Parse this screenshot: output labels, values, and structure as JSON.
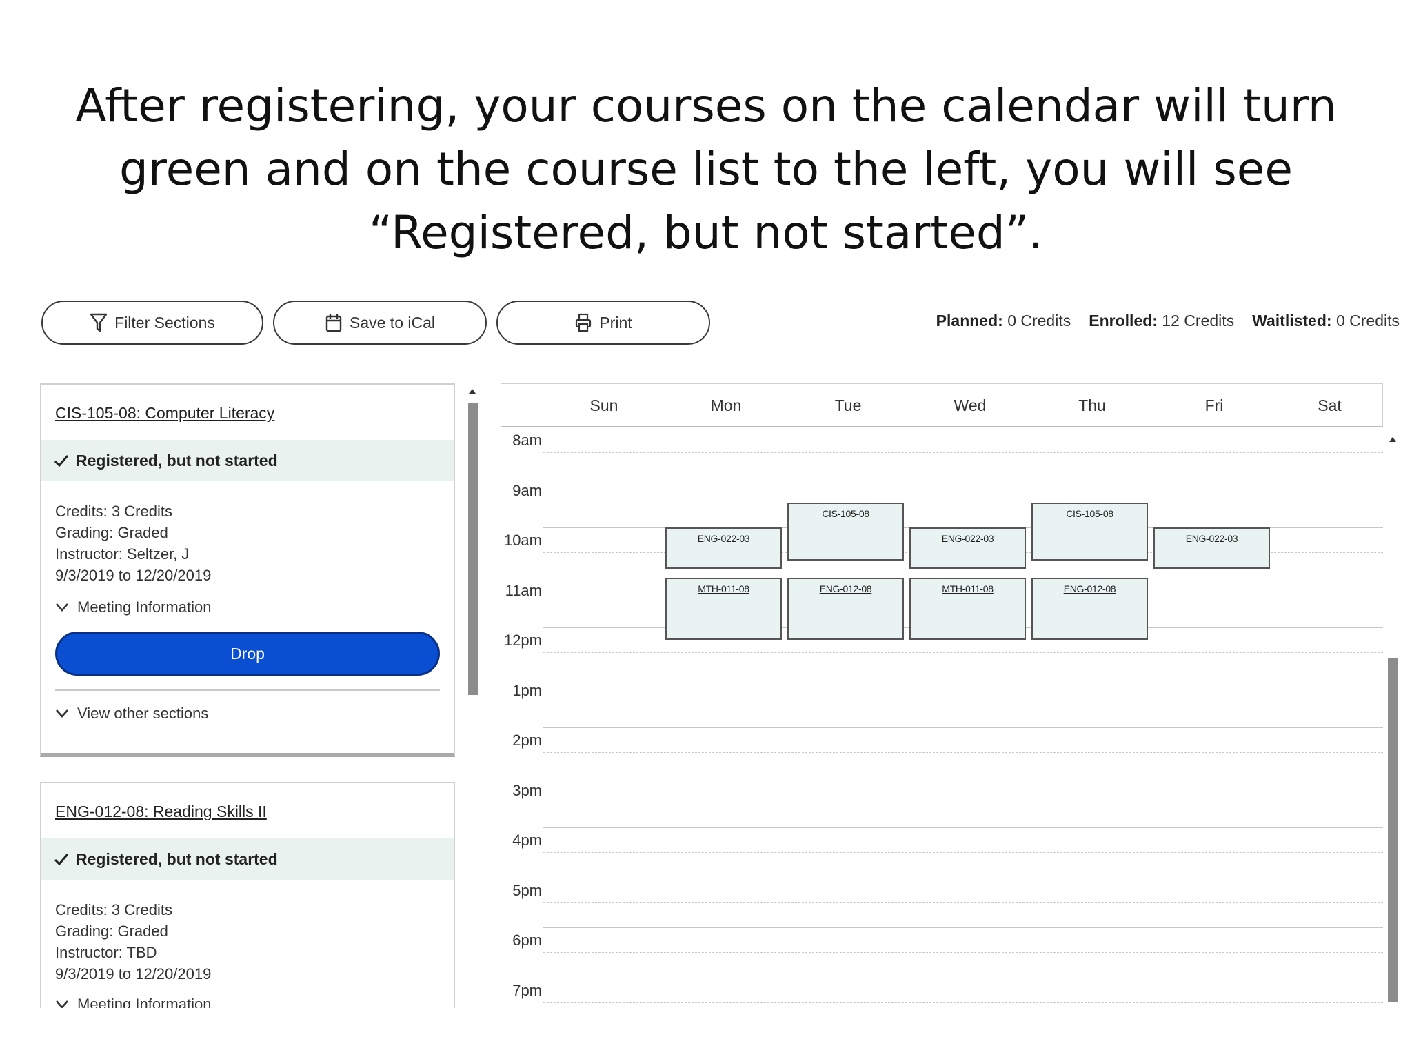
{
  "slide": {
    "title": "After registering, your courses on the calendar will turn green and on the course list to the left, you will see “Registered, but not started”."
  },
  "toolbar": {
    "filter_label": "Filter Sections",
    "ical_label": "Save to iCal",
    "print_label": "Print"
  },
  "credits": {
    "planned_label": "Planned:",
    "planned_value": "0 Credits",
    "enrolled_label": "Enrolled:",
    "enrolled_value": "12 Credits",
    "waitlisted_label": "Waitlisted:",
    "waitlisted_value": "0 Credits"
  },
  "courses": [
    {
      "title": "CIS-105-08: Computer Literacy",
      "status": "Registered, but not started",
      "credits": "Credits: 3 Credits",
      "grading": "Grading: Graded",
      "instructor": "Instructor: Seltzer, J",
      "dates": "9/3/2019 to 12/20/2019",
      "meeting_label": "Meeting Information",
      "drop_label": "Drop",
      "other_sections_label": "View other sections"
    },
    {
      "title": "ENG-012-08: Reading Skills II",
      "status": "Registered, but not started",
      "credits": "Credits: 3 Credits",
      "grading": "Grading: Graded",
      "instructor": "Instructor: TBD",
      "dates": "9/3/2019 to 12/20/2019",
      "meeting_label": "Meeting Information"
    }
  ],
  "calendar": {
    "days": [
      "Sun",
      "Mon",
      "Tue",
      "Wed",
      "Thu",
      "Fri",
      "Sat"
    ],
    "hours": [
      "8am",
      "9am",
      "10am",
      "11am",
      "12pm",
      "1pm",
      "2pm",
      "3pm",
      "4pm",
      "5pm",
      "6pm",
      "7pm"
    ],
    "events": [
      {
        "code": "CIS-105-08",
        "day": "Tue",
        "start": "9:30",
        "end": "10:40"
      },
      {
        "code": "CIS-105-08",
        "day": "Thu",
        "start": "9:30",
        "end": "10:40"
      },
      {
        "code": "ENG-022-03",
        "day": "Mon",
        "start": "10:00",
        "end": "10:50"
      },
      {
        "code": "ENG-022-03",
        "day": "Wed",
        "start": "10:00",
        "end": "10:50"
      },
      {
        "code": "ENG-022-03",
        "day": "Fri",
        "start": "10:00",
        "end": "10:50"
      },
      {
        "code": "MTH-011-08",
        "day": "Mon",
        "start": "11:00",
        "end": "12:15"
      },
      {
        "code": "ENG-012-08",
        "day": "Tue",
        "start": "11:00",
        "end": "12:15"
      },
      {
        "code": "MTH-011-08",
        "day": "Wed",
        "start": "11:00",
        "end": "12:15"
      },
      {
        "code": "ENG-012-08",
        "day": "Thu",
        "start": "11:00",
        "end": "12:15"
      }
    ],
    "event_color": "#e9f3f1",
    "event_border_color": "#555555"
  },
  "colors": {
    "drop_button": "#0a4fd1",
    "status_bar": "#e9f2ee"
  }
}
